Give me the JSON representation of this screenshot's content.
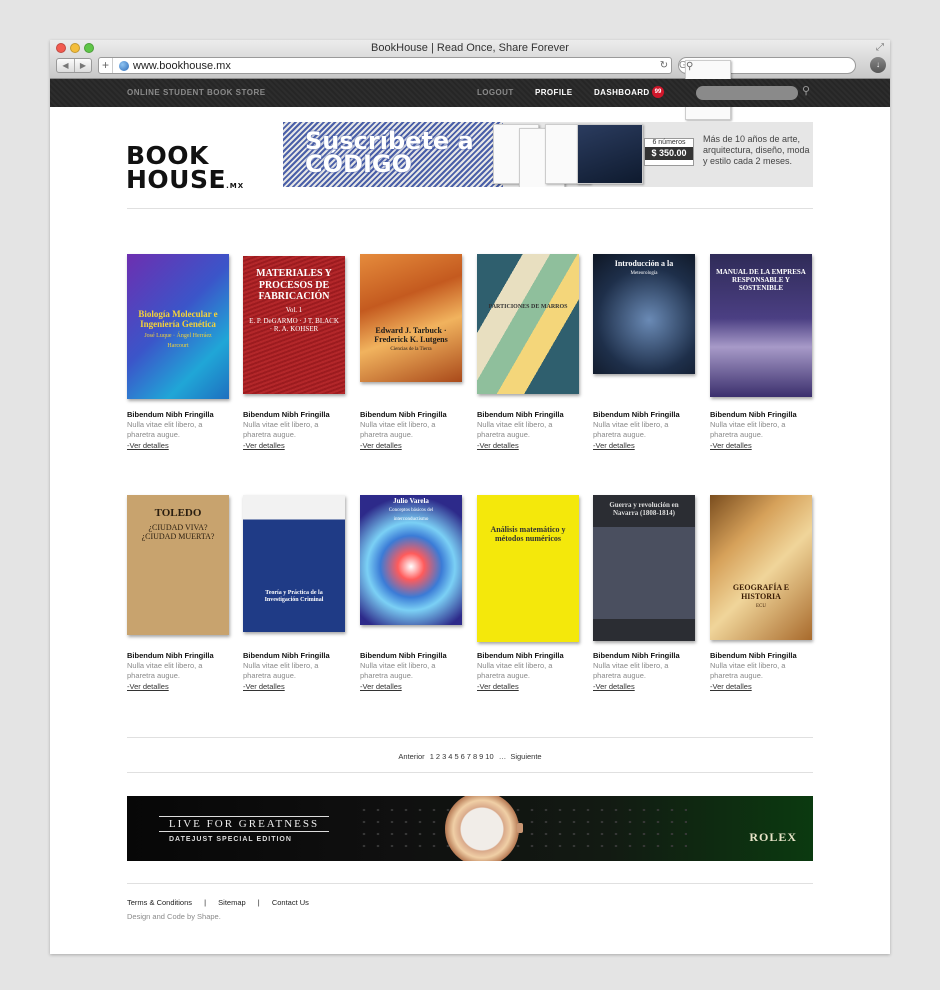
{
  "browser": {
    "title": "BookHouse | Read Once, Share Forever",
    "url": "www.bookhouse.mx",
    "search_placeholder": "Google"
  },
  "topbar": {
    "store_label": "ONLINE STUDENT BOOK STORE",
    "nav": {
      "logout": "LOGOUT",
      "profile": "PROFILE",
      "dashboard": "DASHBOARD"
    },
    "badge_count": "99"
  },
  "logo": {
    "line1": "BOOK",
    "line2": "HOUSE",
    "suffix": ".MX"
  },
  "promo": {
    "headline_1": "Suscríbete a",
    "headline_2": "CÓDIGO",
    "issues_label": "6 números",
    "price": "$ 350.00",
    "copy": "Más de 10 años de arte, arquitectura, diseño, moda y estilo cada 2 meses."
  },
  "books": [
    {
      "cover_lines": [
        "Biología Molecular e Ingeniería Genética",
        "José Luque · Ángel Herráez",
        "Harcourt"
      ],
      "title": "Bibendum Nibh Fringilla",
      "desc": "Nulla vitae elit libero, a pharetra augue.",
      "link": "-Ver detalles"
    },
    {
      "cover_lines": [
        "MATERIALES Y PROCESOS DE FABRICACIÓN",
        "Vol. 1",
        "E. P. DeGARMO · J T. BLACK · R. A. KOHSER"
      ],
      "title": "Bibendum Nibh Fringilla",
      "desc": "Nulla vitae elit libero, a pharetra augue.",
      "link": "-Ver detalles"
    },
    {
      "cover_lines": [
        "Edward J. Tarbuck · Frederick K. Lutgens",
        "Ciencias de la Tierra",
        ""
      ],
      "title": "Bibendum Nibh Fringilla",
      "desc": "Nulla vitae elit libero, a pharetra augue.",
      "link": "-Ver detalles"
    },
    {
      "cover_lines": [
        "PARTICIONES DE MARROS",
        "",
        ""
      ],
      "title": "Bibendum Nibh Fringilla",
      "desc": "Nulla vitae elit libero, a pharetra augue.",
      "link": "-Ver detalles"
    },
    {
      "cover_lines": [
        "Introducción a la",
        "Meteorología",
        ""
      ],
      "title": "Bibendum Nibh Fringilla",
      "desc": "Nulla vitae elit libero, a pharetra augue.",
      "link": "-Ver detalles"
    },
    {
      "cover_lines": [
        "MANUAL DE LA EMPRESA RESPONSABLE Y SOSTENIBLE",
        "",
        ""
      ],
      "title": "Bibendum Nibh Fringilla",
      "desc": "Nulla vitae elit libero, a pharetra augue.",
      "link": "-Ver detalles"
    },
    {
      "cover_lines": [
        "TOLEDO",
        "¿CIUDAD VIVA? ¿CIUDAD MUERTA?",
        ""
      ],
      "title": "Bibendum Nibh Fringilla",
      "desc": "Nulla vitae elit libero, a pharetra augue.",
      "link": "-Ver detalles"
    },
    {
      "cover_lines": [
        "Teoría y Práctica de la Investigación Criminal",
        "",
        ""
      ],
      "title": "Bibendum Nibh Fringilla",
      "desc": "Nulla vitae elit libero, a pharetra augue.",
      "link": "-Ver detalles"
    },
    {
      "cover_lines": [
        "Julio Varela",
        "Conceptos básicos del",
        "interconductismo"
      ],
      "title": "Bibendum Nibh Fringilla",
      "desc": "Nulla vitae elit libero, a pharetra augue.",
      "link": "-Ver detalles"
    },
    {
      "cover_lines": [
        "Análisis matemático y métodos numéricos",
        "",
        ""
      ],
      "title": "Bibendum Nibh Fringilla",
      "desc": "Nulla vitae elit libero, a pharetra augue.",
      "link": "-Ver detalles"
    },
    {
      "cover_lines": [
        "Guerra y revolución en Navarra (1808-1814)",
        "",
        ""
      ],
      "title": "Bibendum Nibh Fringilla",
      "desc": "Nulla vitae elit libero, a pharetra augue.",
      "link": "-Ver detalles"
    },
    {
      "cover_lines": [
        "GEOGRAFÍA E HISTORIA",
        "ECU",
        ""
      ],
      "title": "Bibendum Nibh Fringilla",
      "desc": "Nulla vitae elit libero, a pharetra augue.",
      "link": "-Ver detalles"
    }
  ],
  "pagination": {
    "prev": "Anterior",
    "pages": [
      "1",
      "2",
      "3",
      "4",
      "5",
      "6",
      "7",
      "8",
      "9",
      "10"
    ],
    "ellipsis": "…",
    "next": "Siguiente"
  },
  "ad": {
    "tagline": "LIVE FOR GREATNESS",
    "subline": "DATEJUST SPECIAL EDITION",
    "brand": "ROLEX"
  },
  "footer": {
    "links": [
      "Terms & Conditions",
      "Sitemap",
      "Contact Us"
    ],
    "separator": "|",
    "credit": "Design and Code by Shape."
  },
  "colors": {
    "topbar_bg": "#262626",
    "badge": "#d0162a",
    "promo_stripe": "#4a5fa8"
  }
}
